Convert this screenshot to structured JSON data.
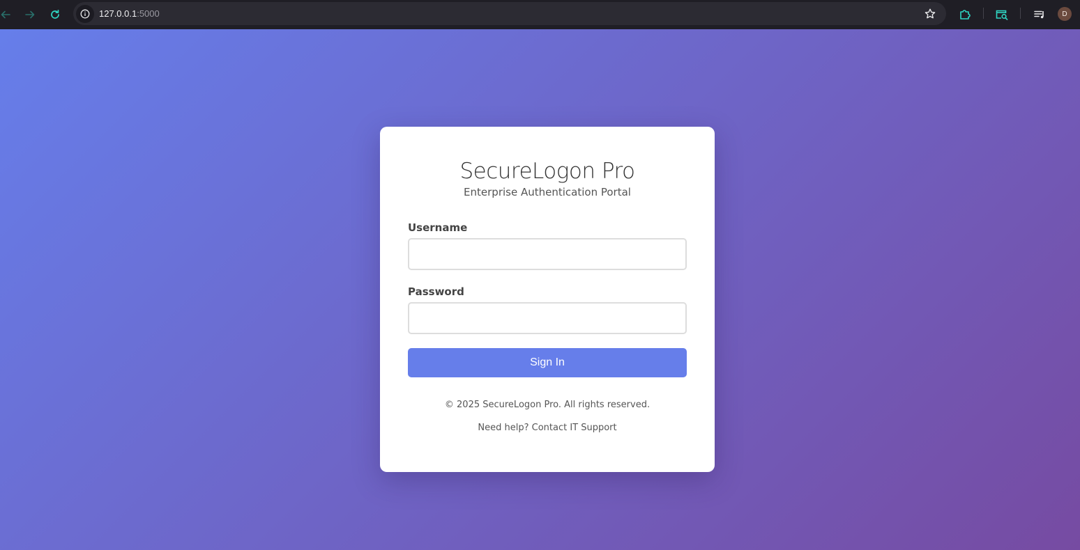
{
  "browser": {
    "url_host": "127.0.0.1",
    "url_port": ":5000",
    "profile_initial": "D",
    "icons": [
      "back-icon",
      "forward-icon",
      "reload-icon",
      "site-info-icon",
      "bookmark-star-icon",
      "extensions-icon",
      "search-tab-icon",
      "reading-list-icon"
    ]
  },
  "login": {
    "title": "SecureLogon Pro",
    "subtitle": "Enterprise Authentication Portal",
    "username_label": "Username",
    "username_value": "",
    "password_label": "Password",
    "password_value": "",
    "sign_in_label": "Sign In",
    "copyright": "© 2025 SecureLogon Pro. All rights reserved.",
    "help_text": "Need help? Contact IT Support"
  },
  "colors": {
    "gradient_start": "#667eea",
    "gradient_end": "#764ba2",
    "button": "#667eea",
    "accent_icon": "#2fd6c3"
  }
}
